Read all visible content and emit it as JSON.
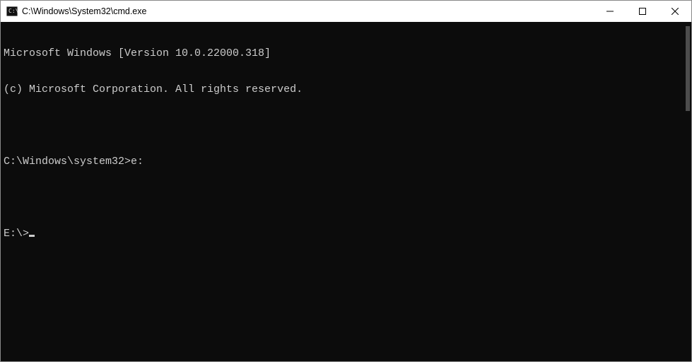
{
  "window": {
    "title": "C:\\Windows\\System32\\cmd.exe"
  },
  "terminal": {
    "lines": [
      "Microsoft Windows [Version 10.0.22000.318]",
      "(c) Microsoft Corporation. All rights reserved.",
      "",
      "C:\\Windows\\system32>e:",
      "",
      "E:\\>"
    ]
  }
}
